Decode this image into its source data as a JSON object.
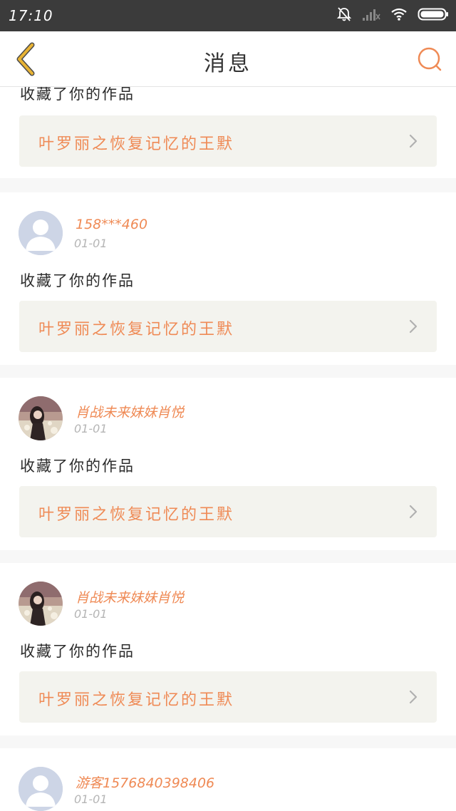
{
  "status_bar": {
    "time": "17:10",
    "icons": [
      "bell-muted-icon",
      "signal-icon",
      "wifi-icon",
      "battery-icon"
    ]
  },
  "header": {
    "title": "消息",
    "back_icon": "chevron-left-icon",
    "search_icon": "search-icon"
  },
  "colors": {
    "accent": "#ef8a55",
    "back_arrow": "#e8b334",
    "card_link_bg": "#f3f3ee",
    "page_bg": "#f7f7f7"
  },
  "messages": [
    {
      "action": "收藏了你的作品",
      "work_title": "叶罗丽之恢复记忆的王默"
    },
    {
      "user": "158***460",
      "date": "01-01",
      "avatar": "default-avatar",
      "action": "收藏了你的作品",
      "work_title": "叶罗丽之恢复记忆的王默"
    },
    {
      "user": "肖战未来妹妹肖悦",
      "date": "01-01",
      "avatar": "photo-avatar",
      "action": "收藏了你的作品",
      "work_title": "叶罗丽之恢复记忆的王默"
    },
    {
      "user": "肖战未来妹妹肖悦",
      "date": "01-01",
      "avatar": "photo-avatar",
      "action": "收藏了你的作品",
      "work_title": "叶罗丽之恢复记忆的王默"
    },
    {
      "user": "游客1576840398406",
      "date": "01-01",
      "avatar": "default-avatar"
    }
  ]
}
